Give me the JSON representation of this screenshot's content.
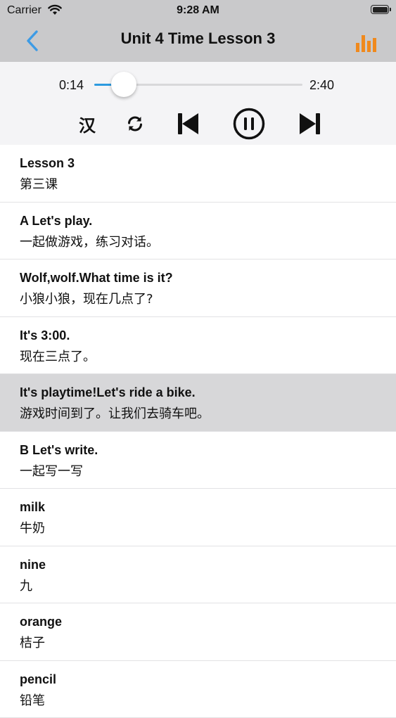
{
  "status_bar": {
    "carrier": "Carrier",
    "time": "9:28 AM"
  },
  "nav": {
    "title": "Unit 4 Time Lesson 3",
    "back_icon": "chevron-left-icon",
    "stats_icon": "bar-chart-icon",
    "accent": "#3d9be5",
    "stats_color": "#f0891d"
  },
  "player": {
    "current_time": "0:14",
    "total_time": "2:40",
    "progress": 0.0875,
    "translate_toggle": "汉",
    "repeat_icon": "repeat-icon",
    "prev_icon": "skip-previous-icon",
    "pause_icon": "pause-icon",
    "next_icon": "skip-next-icon",
    "progress_color": "#2d9be0"
  },
  "lines": [
    {
      "en": "Lesson 3",
      "zh": "第三课",
      "active": false
    },
    {
      "en": "A Let's play.",
      "zh": "一起做游戏，练习对话。",
      "active": false
    },
    {
      "en": "Wolf,wolf.What time is it?",
      "zh": "小狼小狼，现在几点了?",
      "active": false
    },
    {
      "en": "It's 3:00.",
      "zh": "现在三点了。",
      "active": false
    },
    {
      "en": "It's playtime!Let's ride a bike.",
      "zh": "游戏时间到了。让我们去骑车吧。",
      "active": true
    },
    {
      "en": "B Let's write.",
      "zh": "一起写一写",
      "active": false
    },
    {
      "en": "milk",
      "zh": "牛奶",
      "active": false
    },
    {
      "en": "nine",
      "zh": "九",
      "active": false
    },
    {
      "en": "orange",
      "zh": "桔子",
      "active": false
    },
    {
      "en": "pencil",
      "zh": "铅笔",
      "active": false
    }
  ]
}
